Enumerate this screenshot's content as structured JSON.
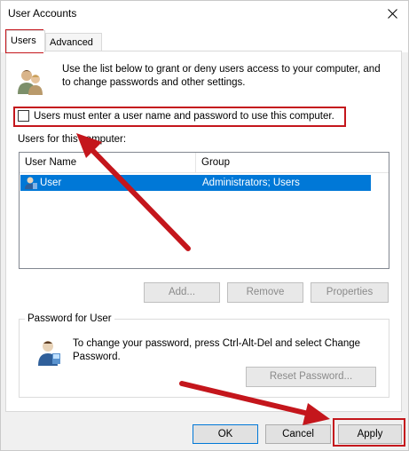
{
  "window": {
    "title": "User Accounts"
  },
  "tabs": [
    {
      "label": "Users",
      "active": true
    },
    {
      "label": "Advanced",
      "active": false
    }
  ],
  "intro": {
    "text": "Use the list below to grant or deny users access to your computer, and to change passwords and other settings."
  },
  "require_login": {
    "label": "Users must enter a user name and password to use this computer.",
    "checked": false
  },
  "users_list": {
    "label": "Users for this computer:",
    "columns": [
      "User Name",
      "Group"
    ],
    "rows": [
      {
        "name": "User",
        "group": "Administrators; Users",
        "selected": true
      }
    ]
  },
  "list_buttons": {
    "add": "Add...",
    "remove": "Remove",
    "properties": "Properties"
  },
  "password_group": {
    "legend": "Password for User",
    "text": "To change your password, press Ctrl-Alt-Del and select Change Password.",
    "reset_button": "Reset Password..."
  },
  "dialog_buttons": {
    "ok": "OK",
    "cancel": "Cancel",
    "apply": "Apply"
  },
  "colors": {
    "annotation": "#c4161c",
    "selection": "#0078d7"
  }
}
